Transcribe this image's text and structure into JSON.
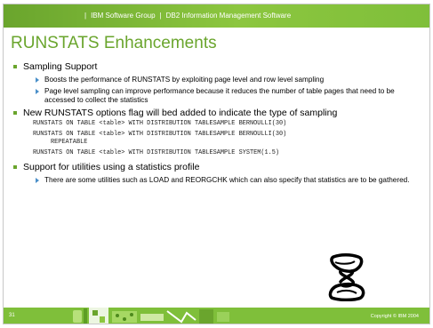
{
  "header": {
    "group": "IBM Software Group",
    "product": "DB2 Information Management Software"
  },
  "slide": {
    "title": "RUNSTATS Enhancements",
    "bullets": [
      {
        "text": "Sampling Support",
        "subs": [
          "Boosts the performance of RUNSTATS by exploiting page level and row level sampling",
          "Page level sampling can improve performance because it reduces the number of table pages that need to be accessed to collect the statistics"
        ]
      },
      {
        "text": "New RUNSTATS options flag will bed added to indicate the type of sampling",
        "code": [
          "RUNSTATS ON TABLE <table> WITH DISTRIBUTION TABLESAMPLE BERNOULLI(30)",
          "RUNSTATS ON TABLE <table> WITH DISTRIBUTION TABLESAMPLE BERNOULLI(30)",
          "REPEATABLE",
          "RUNSTATS ON TABLE <table> WITH DISTRIBUTION TABLESAMPLE SYSTEM(1.5)"
        ]
      },
      {
        "text": "Support for utilities using a statistics profile",
        "subs": [
          "There are some utilities such as LOAD and REORGCHK which can also specify that statistics are to be gathered."
        ]
      }
    ]
  },
  "footer": {
    "page_number": "31",
    "copyright": "Copyright © IBM 2004"
  },
  "logo_icon": "hourglass-logo-icon",
  "colors": {
    "accent_green": "#6aa52d",
    "bar_green": "#7fbf3a",
    "sub_bullet_blue": "#4a8fc9"
  }
}
